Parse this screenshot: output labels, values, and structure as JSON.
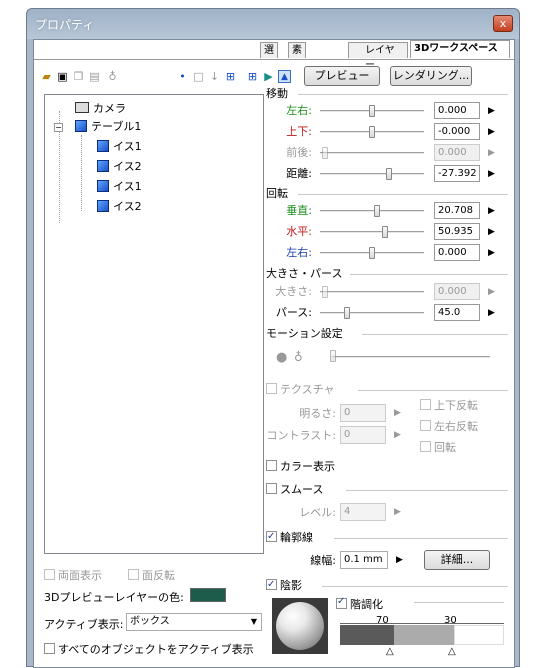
{
  "window": {
    "title": "プロパティ",
    "close": "x"
  },
  "tabs": [
    {
      "label": "選"
    },
    {
      "label": "素"
    },
    {
      "label": "レイヤー"
    },
    {
      "label": "3Dワークスペース"
    }
  ],
  "toolbar": {
    "preview": "プレビュー",
    "render": "レンダリング..."
  },
  "tree": {
    "items": [
      "カメラ",
      "テーブル1",
      "イス1",
      "イス2",
      "イス1",
      "イス2"
    ]
  },
  "move": {
    "title": "移動",
    "rows": [
      {
        "label": "左右:",
        "value": "0.000",
        "color": "#1a8f1a"
      },
      {
        "label": "上下:",
        "value": "-0.000",
        "color": "#c01a1a"
      },
      {
        "label": "前後:",
        "value": "0.000",
        "color": "#999999"
      },
      {
        "label": "距離:",
        "value": "-27.392",
        "color": "#000000"
      }
    ]
  },
  "rotate": {
    "title": "回転",
    "rows": [
      {
        "label": "垂直:",
        "value": "20.708",
        "color": "#1a8f1a"
      },
      {
        "label": "水平:",
        "value": "50.935",
        "color": "#c01a1a"
      },
      {
        "label": "左右:",
        "value": "0.000",
        "color": "#1a3fa8"
      }
    ]
  },
  "size": {
    "title": "大きさ・パース",
    "rows": [
      {
        "label": "大きさ:",
        "value": "0.000"
      },
      {
        "label": "パース:",
        "value": "45.0"
      }
    ]
  },
  "motion": {
    "title": "モーション設定"
  },
  "texture": {
    "title": "テクスチャ",
    "brightness_label": "明るさ:",
    "brightness": "0",
    "contrast_label": "コントラスト:",
    "contrast": "0",
    "flip_v": "上下反転",
    "flip_h": "左右反転",
    "rotate": "回転"
  },
  "color_display": {
    "label": "カラー表示"
  },
  "smooth": {
    "label": "スムース",
    "level_label": "レベル:",
    "level": "4"
  },
  "outline": {
    "label": "輪郭線",
    "width_label": "線幅:",
    "width": "0.1 mm",
    "detail": "詳細..."
  },
  "shadow": {
    "label": "陰影",
    "gradation": "階調化",
    "val1": "70",
    "val2": "30"
  },
  "left_bottom": {
    "double_side": "両面表示",
    "face_flip": "面反転",
    "preview_color_label": "3Dプレビューレイヤーの色:",
    "preview_color": "#1d5c4a",
    "active_label": "アクティブ表示:",
    "active_value": "ボックス",
    "all_active": "すべてのオブジェクトをアクティブ表示"
  }
}
